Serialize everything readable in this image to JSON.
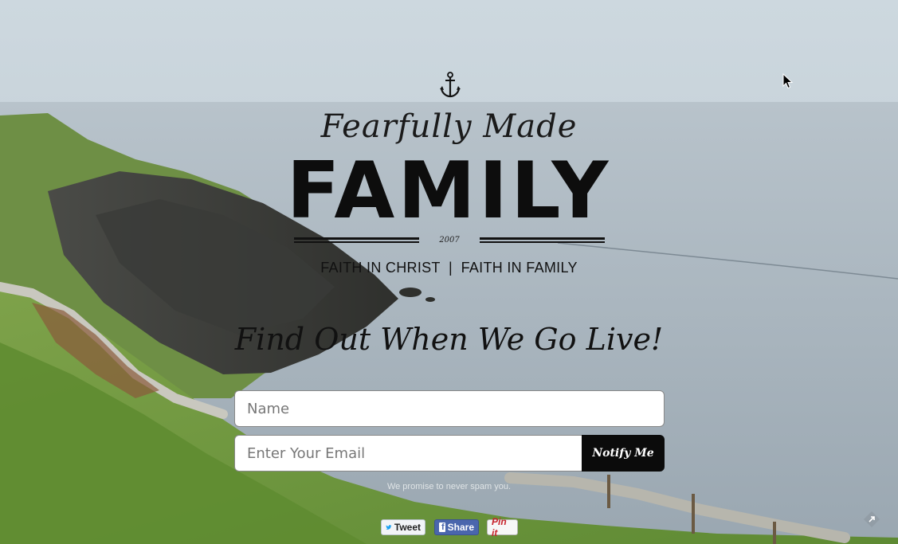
{
  "header": {
    "script_title": "Fearfully Made",
    "main_title": "FAMILY",
    "year": "2007",
    "tagline": "FAITH IN CHRIST  |  FAITH IN FAMILY"
  },
  "signup": {
    "heading": "Find Out When We Go Live!",
    "name_placeholder": "Name",
    "email_placeholder": "Enter Your Email",
    "submit_label": "Notify Me",
    "promise_text": "We promise to never spam you."
  },
  "share": {
    "tweet_label": "Tweet",
    "facebook_label": "Share",
    "pinterest_label": "Pin it"
  },
  "icons": {
    "logo": "anchor-icon",
    "twitter": "twitter-bird-icon",
    "facebook": "facebook-f-icon",
    "cursor": "mouse-pointer-icon",
    "corner": "diamond-arrow-icon"
  },
  "colors": {
    "title_text": "#0d0d0d",
    "button_bg": "#0b0b0b",
    "facebook_blue": "#4a66ad",
    "pinterest_red": "#c8232c",
    "sea": "#a9b4bd",
    "grass": "#6f9a3e"
  }
}
